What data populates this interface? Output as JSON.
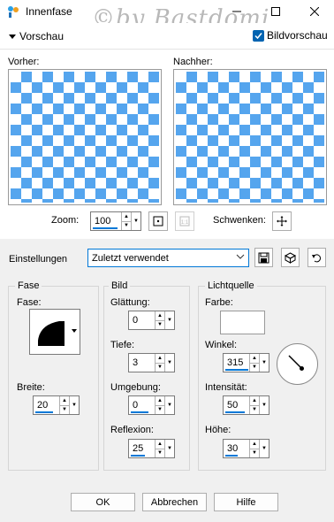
{
  "window": {
    "title": "Innenfase",
    "watermark": "©by Bastdomi"
  },
  "preview_bar": {
    "vorschau_label": "Vorschau",
    "bildvorschau_label": "Bildvorschau",
    "bildvorschau_checked": true
  },
  "panes": {
    "before_label": "Vorher:",
    "after_label": "Nachher:"
  },
  "zoom": {
    "label": "Zoom:",
    "value": "100",
    "fit_icon": "fit-window-icon",
    "actual_size_icon": "actual-size-icon"
  },
  "pan": {
    "label": "Schwenken:",
    "icon": "pan-icon"
  },
  "settings": {
    "label": "Einstellungen",
    "preset": "Zuletzt verwendet"
  },
  "fase": {
    "title": "Fase",
    "fase_label": "Fase:",
    "breite_label": "Breite:",
    "breite_value": "20"
  },
  "bild": {
    "title": "Bild",
    "glaettung_label": "Glättung:",
    "glaettung_value": "0",
    "tiefe_label": "Tiefe:",
    "tiefe_value": "3",
    "umgebung_label": "Umgebung:",
    "umgebung_value": "0",
    "reflexion_label": "Reflexion:",
    "reflexion_value": "25"
  },
  "lichtquelle": {
    "title": "Lichtquelle",
    "farbe_label": "Farbe:",
    "farbe_color": "#ffffff",
    "winkel_label": "Winkel:",
    "winkel_value": "315",
    "intensitaet_label": "Intensität:",
    "intensitaet_value": "50",
    "hoehe_label": "Höhe:",
    "hoehe_value": "30"
  },
  "buttons": {
    "ok": "OK",
    "cancel": "Abbrechen",
    "help": "Hilfe"
  },
  "colors": {
    "checker_blue": "#55a5ee",
    "accent": "#0078d7"
  }
}
